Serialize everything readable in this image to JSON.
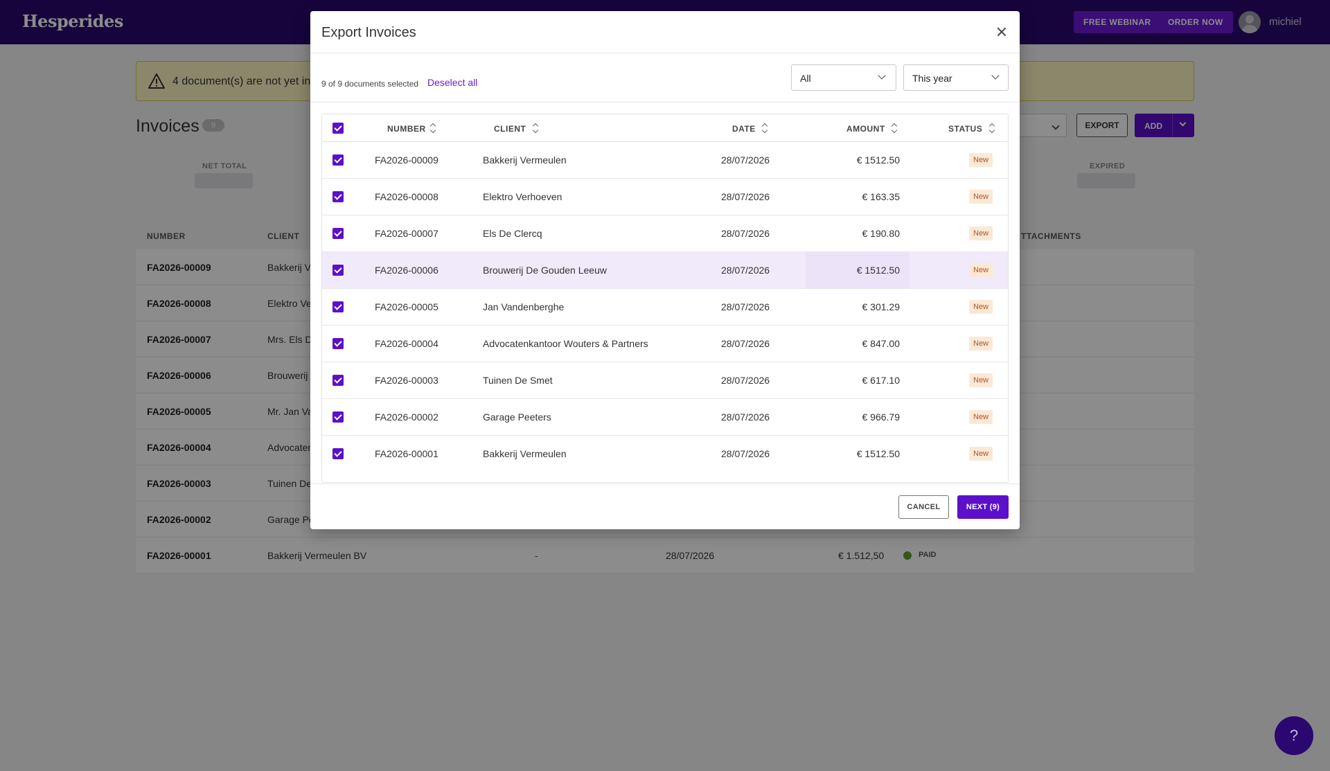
{
  "app": {
    "logo": "Hesperides",
    "webinar_label": "FREE WEBINAR",
    "order_label": "ORDER NOW",
    "username": "michiel"
  },
  "background": {
    "alert_text": "4 document(s) are not yet in",
    "title": "Invoices",
    "count": "9",
    "export_label": "EXPORT",
    "add_label": "ADD",
    "kpi": {
      "net_total": "NET TOTAL",
      "expired": "EXPIRED"
    },
    "headers": {
      "number": "NUMBER",
      "client": "CLIENT",
      "attachments": "TTACHMENTS"
    },
    "rows": [
      {
        "number": "FA2026-00009",
        "client": "Bakkerij V"
      },
      {
        "number": "FA2026-00008",
        "client": "Elektro Ve"
      },
      {
        "number": "FA2026-00007",
        "client": "Mrs. Els D"
      },
      {
        "number": "FA2026-00006",
        "client": "Brouwerij"
      },
      {
        "number": "FA2026-00005",
        "client": "Mr. Jan Va"
      },
      {
        "number": "FA2026-00004",
        "client": "Advocaten"
      },
      {
        "number": "FA2026-00003",
        "client": "Tuinen De"
      },
      {
        "number": "FA2026-00002",
        "client": "Garage Pe"
      },
      {
        "number": "FA2026-00001",
        "client": "Bakkerij Vermeulen BV",
        "dash": "-",
        "date": "28/07/2026",
        "amount": "€ 1.512,50",
        "status": "PAID"
      }
    ],
    "help_label": "?"
  },
  "modal": {
    "title": "Export Invoices",
    "selection_text": "9 of 9 documents selected",
    "deselect_label": "Deselect all",
    "type_filter": "All",
    "period_filter": "This year",
    "columns": {
      "number": "NUMBER",
      "client": "CLIENT",
      "date": "DATE",
      "amount": "AMOUNT",
      "status": "STATUS"
    },
    "rows": [
      {
        "number": "FA2026-00009",
        "client": "Bakkerij Vermeulen",
        "date": "28/07/2026",
        "amount": "€ 1512.50",
        "status": "New"
      },
      {
        "number": "FA2026-00008",
        "client": "Elektro Verhoeven",
        "date": "28/07/2026",
        "amount": "€ 163.35",
        "status": "New"
      },
      {
        "number": "FA2026-00007",
        "client": "Els De Clercq",
        "date": "28/07/2026",
        "amount": "€ 190.80",
        "status": "New"
      },
      {
        "number": "FA2026-00006",
        "client": "Brouwerij De Gouden Leeuw",
        "date": "28/07/2026",
        "amount": "€ 1512.50",
        "status": "New"
      },
      {
        "number": "FA2026-00005",
        "client": "Jan Vandenberghe",
        "date": "28/07/2026",
        "amount": "€ 301.29",
        "status": "New"
      },
      {
        "number": "FA2026-00004",
        "client": "Advocatenkantoor Wouters & Partners",
        "date": "28/07/2026",
        "amount": "€ 847.00",
        "status": "New"
      },
      {
        "number": "FA2026-00003",
        "client": "Tuinen De Smet",
        "date": "28/07/2026",
        "amount": "€ 617.10",
        "status": "New"
      },
      {
        "number": "FA2026-00002",
        "client": "Garage Peeters",
        "date": "28/07/2026",
        "amount": "€ 966.79",
        "status": "New"
      },
      {
        "number": "FA2026-00001",
        "client": "Bakkerij Vermeulen",
        "date": "28/07/2026",
        "amount": "€ 1512.50",
        "status": "New"
      }
    ],
    "cancel_label": "CANCEL",
    "next_label": "NEXT (9)"
  },
  "colors": {
    "brand": "#2a0870",
    "accent": "#5c10c9",
    "status_new_bg": "#fce8d6",
    "status_new_text": "#b0521d"
  }
}
